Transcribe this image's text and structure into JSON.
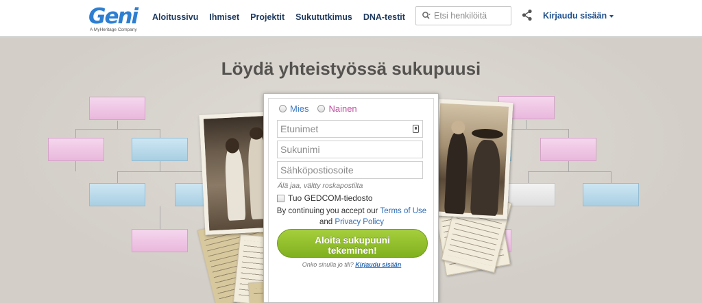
{
  "header": {
    "logo_text": "Geni",
    "logo_tagline": "A MyHeritage Company",
    "nav": [
      "Aloitussivu",
      "Ihmiset",
      "Projektit",
      "Sukututkimus",
      "DNA-testit"
    ],
    "search_placeholder": "Etsi henkilöitä",
    "login_label": "Kirjaudu sisään"
  },
  "hero": {
    "title": "Löydä yhteistyössä sukupuusi"
  },
  "form": {
    "gender_male": "Mies",
    "gender_female": "Nainen",
    "first_names_placeholder": "Etunimet",
    "surname_placeholder": "Sukunimi",
    "email_placeholder": "Sähköpostiosoite",
    "email_hint": "Älä jaa, vältty roskapostilta",
    "gedcom_label": "Tuo GEDCOM-tiedosto",
    "terms_prefix": "By continuing you accept our",
    "terms_link": "Terms of Use",
    "terms_and": "and",
    "privacy_link": "Privacy Policy",
    "cta_label": "Aloita sukupuuni tekeminen!",
    "account_question": "Onko sinulla jo tili?",
    "account_login_link": "Kirjaudu sisään"
  },
  "colors": {
    "brand_blue": "#2d7fd1",
    "male_blue": "#3a78c6",
    "female_pink": "#c04fa0",
    "cta_green": "#8dbd2a"
  }
}
